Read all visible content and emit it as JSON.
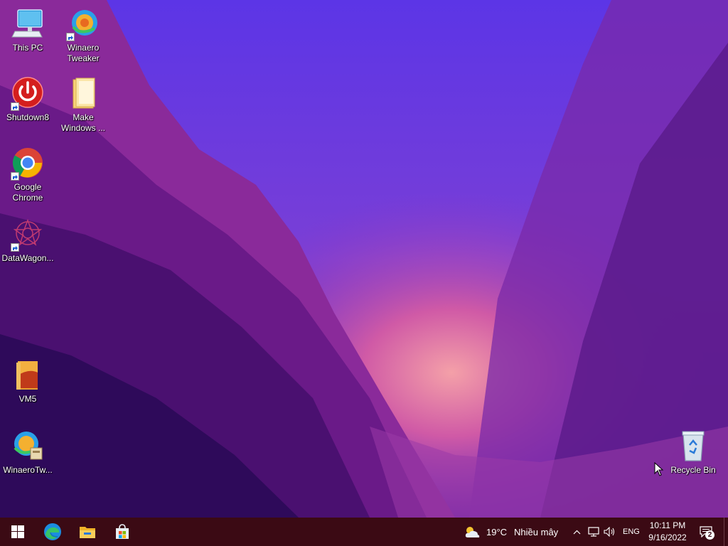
{
  "desktop": {
    "icons": [
      {
        "label": "This PC"
      },
      {
        "label": "Winaero\nTweaker"
      },
      {
        "label": "Shutdown8"
      },
      {
        "label": "Make\nWindows ..."
      },
      {
        "label": "Google\nChrome"
      },
      {
        "label": "DataWagon..."
      },
      {
        "label": "VM5"
      },
      {
        "label": "WinaeroTw..."
      },
      {
        "label": "Recycle Bin"
      }
    ]
  },
  "taskbar": {
    "weather": {
      "temp": "19°C",
      "text": "Nhiều mây"
    },
    "language": "ENG",
    "clock": {
      "time": "10:11 PM",
      "date": "9/16/2022"
    },
    "notification_count": "2"
  },
  "colors": {
    "taskbar_bg": "#3b0a14",
    "wallpaper_sky": "#6a3ee0",
    "wallpaper_glow": "#f08aa0"
  }
}
